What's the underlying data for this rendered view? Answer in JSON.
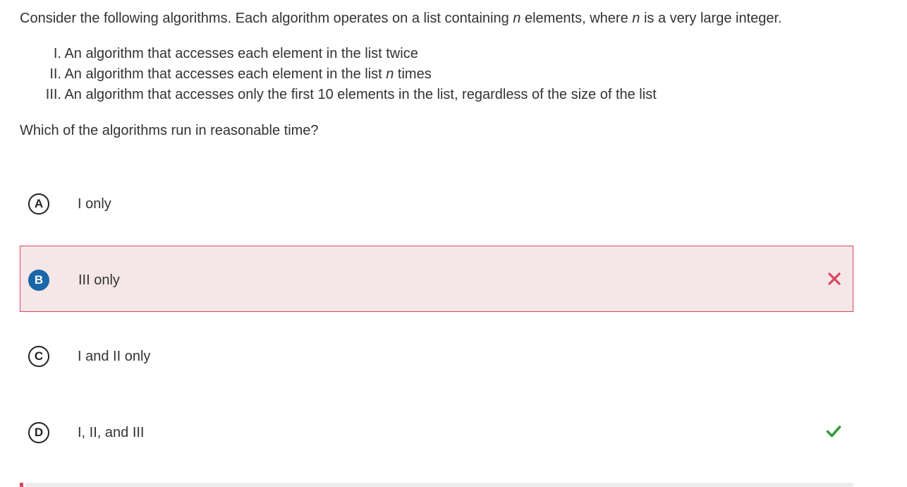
{
  "question": {
    "part1": "Consider the following algorithms. Each algorithm operates on a list containing ",
    "var1": "n",
    "part2": " elements, where ",
    "var2": "n",
    "part3": " is a very large integer."
  },
  "statements": [
    {
      "numeral": "I.",
      "text": "An algorithm that accesses each element in the list twice"
    },
    {
      "numeral": "II.",
      "text_before": "An algorithm that accesses each element in the list ",
      "var": "n",
      "text_after": " times"
    },
    {
      "numeral": "III.",
      "text": "An algorithm that accesses only the first 10 elements in the list, regardless of the size of the list"
    }
  ],
  "prompt": "Which of the algorithms run in reasonable time?",
  "choices": [
    {
      "letter": "A",
      "text": "I only"
    },
    {
      "letter": "B",
      "text": "III only",
      "status": "incorrect"
    },
    {
      "letter": "C",
      "text": "I and II only"
    },
    {
      "letter": "D",
      "text": "I, II, and III",
      "status": "correct"
    }
  ],
  "colors": {
    "incorrect": "#d9465f",
    "correct": "#3a9a3a",
    "selected_letter": "#1a66a8",
    "selected_background": "#f5e6e8"
  },
  "icons": {
    "incorrect": "x-mark-icon",
    "correct": "checkmark-icon"
  }
}
